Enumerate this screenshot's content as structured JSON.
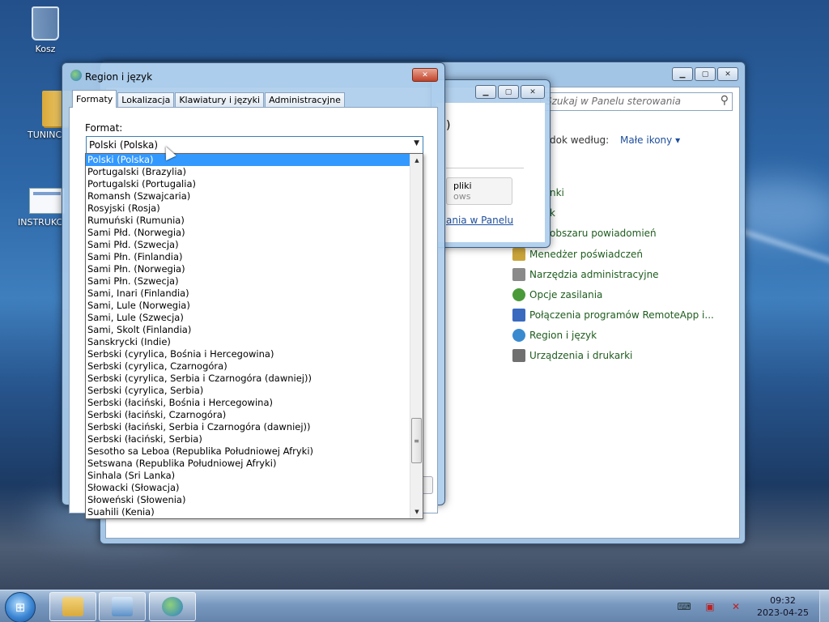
{
  "desktop": {
    "icons": [
      {
        "label": "Kosz"
      },
      {
        "label": "TUNINC"
      },
      {
        "label": "INSTRUKC"
      }
    ]
  },
  "control_panel": {
    "search_placeholder": "Szukaj w Panelu sterowania",
    "view_by_label": "dok według:",
    "view_by_value": "Małe ikony ▾",
    "fragments": [
      "nki",
      "k",
      "obszaru powiadomień"
    ],
    "items": [
      {
        "label": "Menedżer poświadczeń",
        "color": "#c9a43a"
      },
      {
        "label": "Narzędzia administracyjne",
        "color": "#8a8a8a"
      },
      {
        "label": "Opcje zasilania",
        "color": "#4a9a3a"
      },
      {
        "label": "Połączenia programów RemoteApp i...",
        "color": "#3a6ac0"
      },
      {
        "label": "Region i język",
        "color": "#3a8ad0"
      },
      {
        "label": "Urządzenia i drukarki",
        "color": "#707070"
      }
    ]
  },
  "middle_window": {
    "fragment_paren": ")",
    "button_label": "pliki",
    "button_sub": "ows",
    "link": "ania w Panelu"
  },
  "dialog": {
    "title": "Region i język",
    "tabs": [
      "Formaty",
      "Lokalizacja",
      "Klawiatury i języki",
      "Administracyjne"
    ],
    "format_label": "Format:",
    "format_value": "Polski (Polska)",
    "options": [
      "Polski (Polska)",
      "Portugalski (Brazylia)",
      "Portugalski (Portugalia)",
      "Romansh (Szwajcaria)",
      "Rosyjski (Rosja)",
      "Rumuński (Rumunia)",
      "Sami Płd. (Norwegia)",
      "Sami Płd. (Szwecja)",
      "Sami Płn. (Finlandia)",
      "Sami Płn. (Norwegia)",
      "Sami Płn. (Szwecja)",
      "Sami, Inari (Finlandia)",
      "Sami, Lule (Norwegia)",
      "Sami, Lule (Szwecja)",
      "Sami, Skolt (Finlandia)",
      "Sanskrycki (Indie)",
      "Serbski (cyrylica, Bośnia i Hercegowina)",
      "Serbski (cyrylica, Czarnogóra)",
      "Serbski (cyrylica, Serbia i Czarnogóra (dawniej))",
      "Serbski (cyrylica, Serbia)",
      "Serbski (łaciński, Bośnia i Hercegowina)",
      "Serbski (łaciński, Czarnogóra)",
      "Serbski (łaciński, Serbia i Czarnogóra (dawniej))",
      "Serbski (łaciński, Serbia)",
      "Sesotho sa Leboa (Republika Południowej Afryki)",
      "Setswana (Republika Południowej Afryki)",
      "Sinhala (Sri Lanka)",
      "Słowacki (Słowacja)",
      "Słoweński (Słowenia)",
      "Suahili (Kenia)"
    ]
  },
  "taskbar": {
    "time": "09:32",
    "date": "2023-04-25"
  }
}
